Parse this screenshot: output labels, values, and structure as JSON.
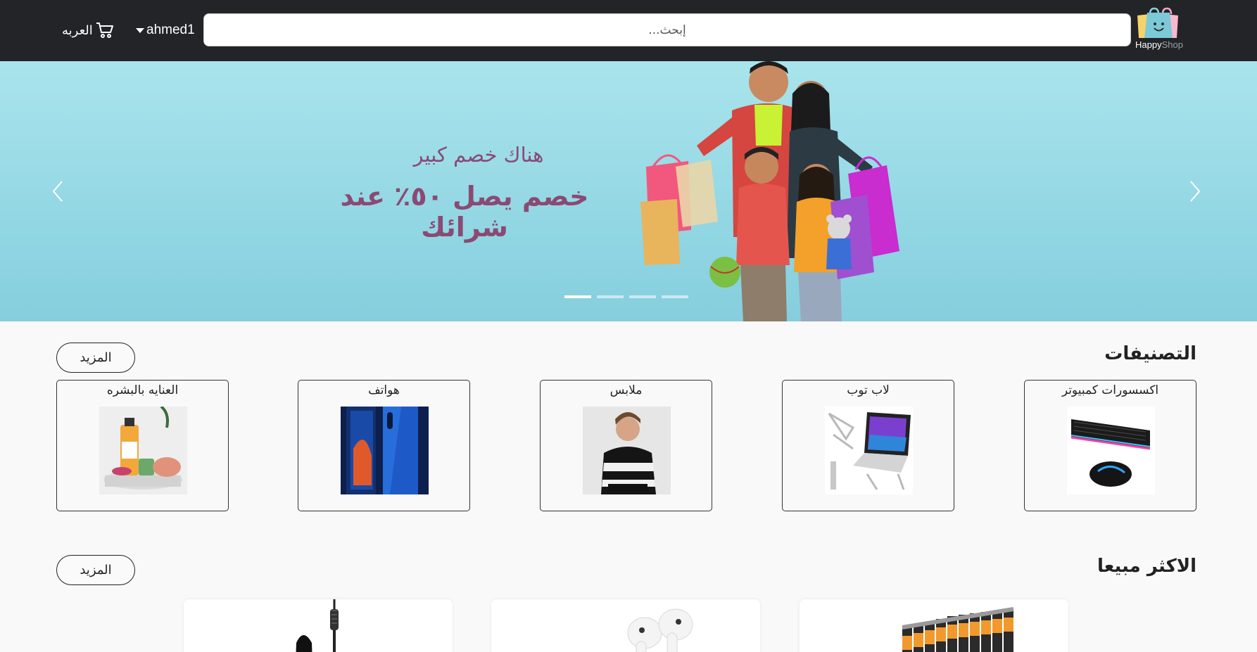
{
  "navbar": {
    "logo": {
      "word1": "Happy",
      "word2": "Shop"
    },
    "search_placeholder": "إبحث...",
    "user_name": "ahmed1",
    "cart_label": "العربه",
    "icons": {
      "cart": "cart-icon",
      "caret": "chevron-down-icon",
      "logo": "shopping-bag-icon"
    }
  },
  "hero": {
    "subtitle": "هناك خصم كبير",
    "title": "خصم يصل ٥٠٪ عند شرائك",
    "slides_count": 4,
    "active_slide": 1,
    "colors": {
      "bg": "#9ddbe6",
      "text": "#8a4a73"
    }
  },
  "categories": {
    "title": "التصنيفات",
    "more_label": "المزيد",
    "items": [
      {
        "label": "اكسسورات كمبيوتر",
        "image": "keyboard-mouse-image"
      },
      {
        "label": "لاب توب",
        "image": "laptop-stand-image"
      },
      {
        "label": "ملابس",
        "image": "man-clothes-image"
      },
      {
        "label": "هواتف",
        "image": "smartphone-image"
      },
      {
        "label": "العنايه بالبشره",
        "image": "skincare-image"
      }
    ]
  },
  "best_sellers": {
    "title": "الاكثر مبيعا",
    "more_label": "المزيد",
    "items": [
      {
        "image": "batteries-image"
      },
      {
        "image": "earbuds-image"
      },
      {
        "image": "mascara-image"
      }
    ]
  },
  "colors": {
    "navbar": "#222428",
    "page": "#f9f9f9",
    "accent": "#8a4a73"
  }
}
